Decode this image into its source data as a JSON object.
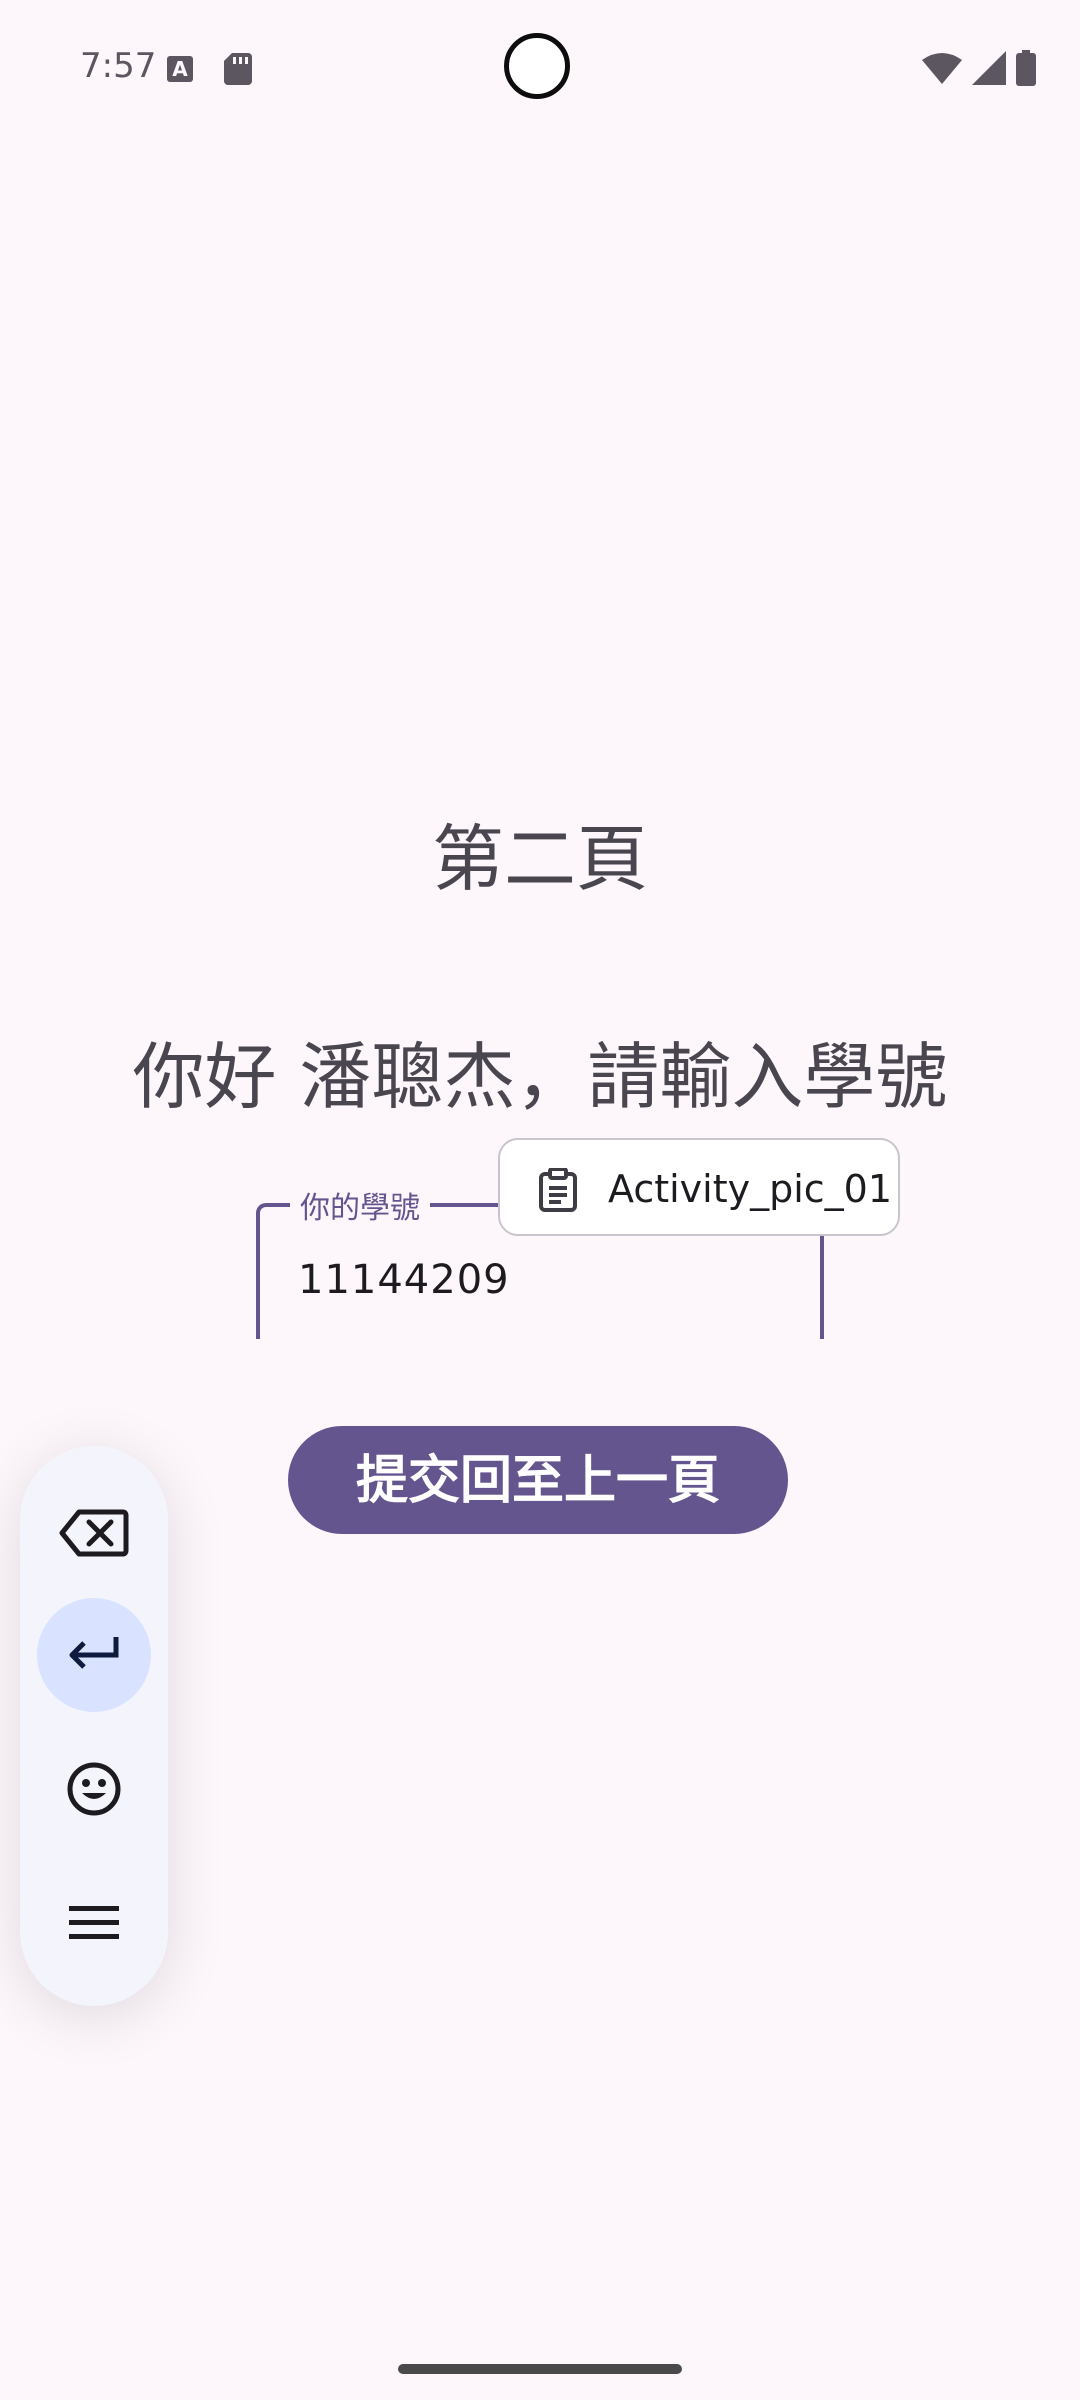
{
  "status_bar": {
    "time": "7:57",
    "notif_icon_a": "A"
  },
  "main": {
    "page_title": "第二頁",
    "greeting": "你好 潘聰杰，請輸入學號",
    "student_id_field": {
      "label": "你的學號",
      "value": "11144209"
    },
    "submit_button": "提交回至上一頁"
  },
  "clipboard_suggestion": {
    "text": "Activity_pic_01",
    "icon": "clipboard-icon"
  },
  "floating_toolbar": {
    "items": [
      {
        "icon": "backspace-icon"
      },
      {
        "icon": "enter-icon",
        "active": true
      },
      {
        "icon": "emoji-icon"
      },
      {
        "icon": "menu-icon"
      }
    ]
  },
  "colors": {
    "background": "#FDF7FC",
    "primary": "#65558F",
    "toolbar_bg": "#F4F5FC",
    "toolbar_active": "#D9E2FF"
  }
}
